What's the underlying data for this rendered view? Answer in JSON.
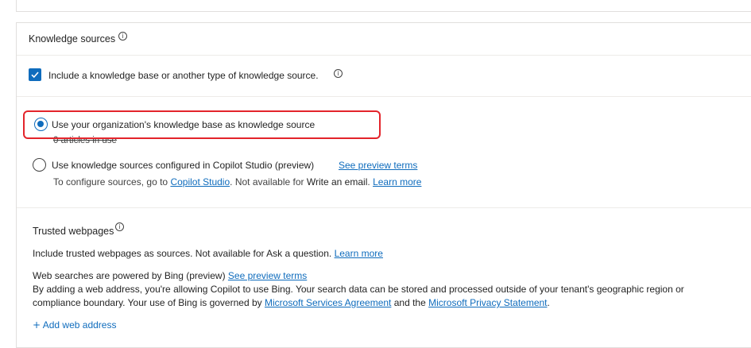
{
  "knowledge_sources": {
    "title": "Knowledge sources",
    "include_checkbox": {
      "label": "Include a knowledge base or another type of knowledge source.",
      "checked": true
    },
    "options": [
      {
        "label": "Use your organization's knowledge base as knowledge source",
        "selected": true,
        "sub": "0 articles in use"
      },
      {
        "label": "Use knowledge sources configured in Copilot Studio (preview)",
        "selected": false,
        "link": "See preview terms",
        "detail_prefix": "To configure sources, go to",
        "detail_link": "Copilot Studio",
        "detail_middle": ". Not available for",
        "detail_bold": "Write an email",
        "detail_end": ".",
        "detail_learn": "Learn more"
      }
    ]
  },
  "trusted_webpages": {
    "title": "Trusted webpages",
    "description_prefix": "Include trusted webpages as sources. Not available for",
    "description_bold": "Ask a question",
    "description_end": ".",
    "learn_more": "Learn more",
    "bing_heading": "Web searches are powered by Bing (preview)",
    "bing_link": "See preview terms",
    "bing_body_line1": "By adding a web address, you're allowing Copilot to use Bing. Your search data can be stored and processed outside of your tenant's geographic region or",
    "bing_body_line2_prefix": "compliance boundary. Your use of Bing is governed by",
    "msa_link": "Microsoft Services Agreement",
    "and_text": "and the",
    "privacy_link": "Microsoft Privacy Statement",
    "end_period": ".",
    "add_web_address": "Add web address"
  },
  "colors": {
    "accent": "#0f6cbd",
    "highlight": "#e3242b"
  }
}
